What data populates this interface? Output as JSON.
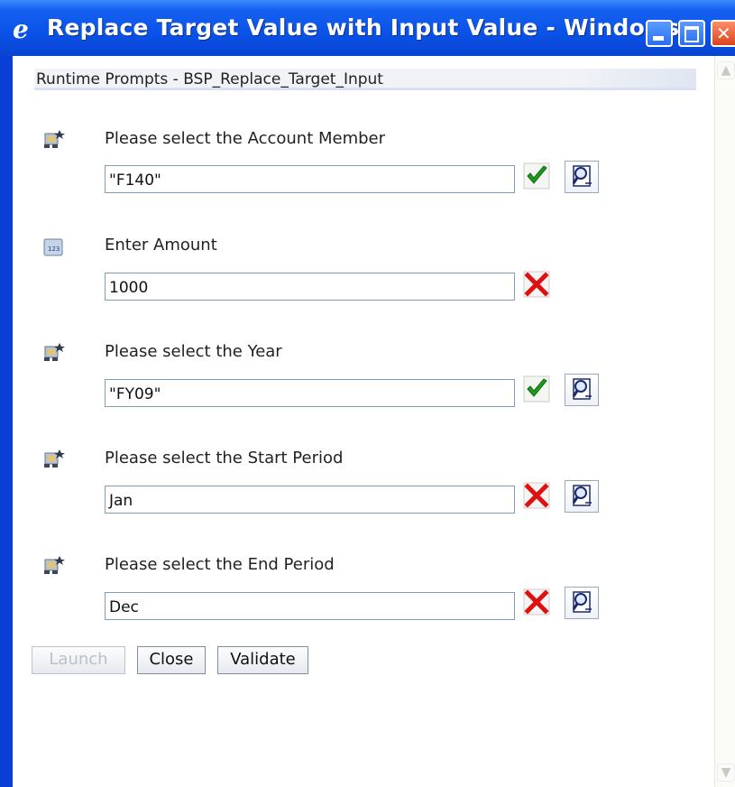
{
  "window": {
    "title": "Replace Target Value with Input Value - Windows...",
    "icon": "ie-icon"
  },
  "header": {
    "title": "Runtime Prompts - BSP_Replace_Target_Input"
  },
  "prompts": [
    {
      "label": "Please select the Account Member",
      "value": "\"F140\"",
      "icon": "member-select-icon",
      "status": "valid",
      "has_lookup": true
    },
    {
      "label": "Enter Amount",
      "value": "1000",
      "icon": "numeric-icon",
      "status": "invalid",
      "has_lookup": false
    },
    {
      "label": "Please select the Year",
      "value": "\"FY09\"",
      "icon": "member-select-icon",
      "status": "valid",
      "has_lookup": true
    },
    {
      "label": "Please select the Start Period",
      "value": "Jan",
      "icon": "member-select-icon",
      "status": "invalid",
      "has_lookup": true
    },
    {
      "label": "Please select the End Period",
      "value": "Dec",
      "icon": "member-select-icon",
      "status": "invalid",
      "has_lookup": true
    }
  ],
  "buttons": {
    "launch": "Launch",
    "close": "Close",
    "validate": "Validate"
  },
  "colors": {
    "titlebar": "#0a52e8",
    "valid": "#1f9b1f",
    "invalid": "#e01010"
  }
}
